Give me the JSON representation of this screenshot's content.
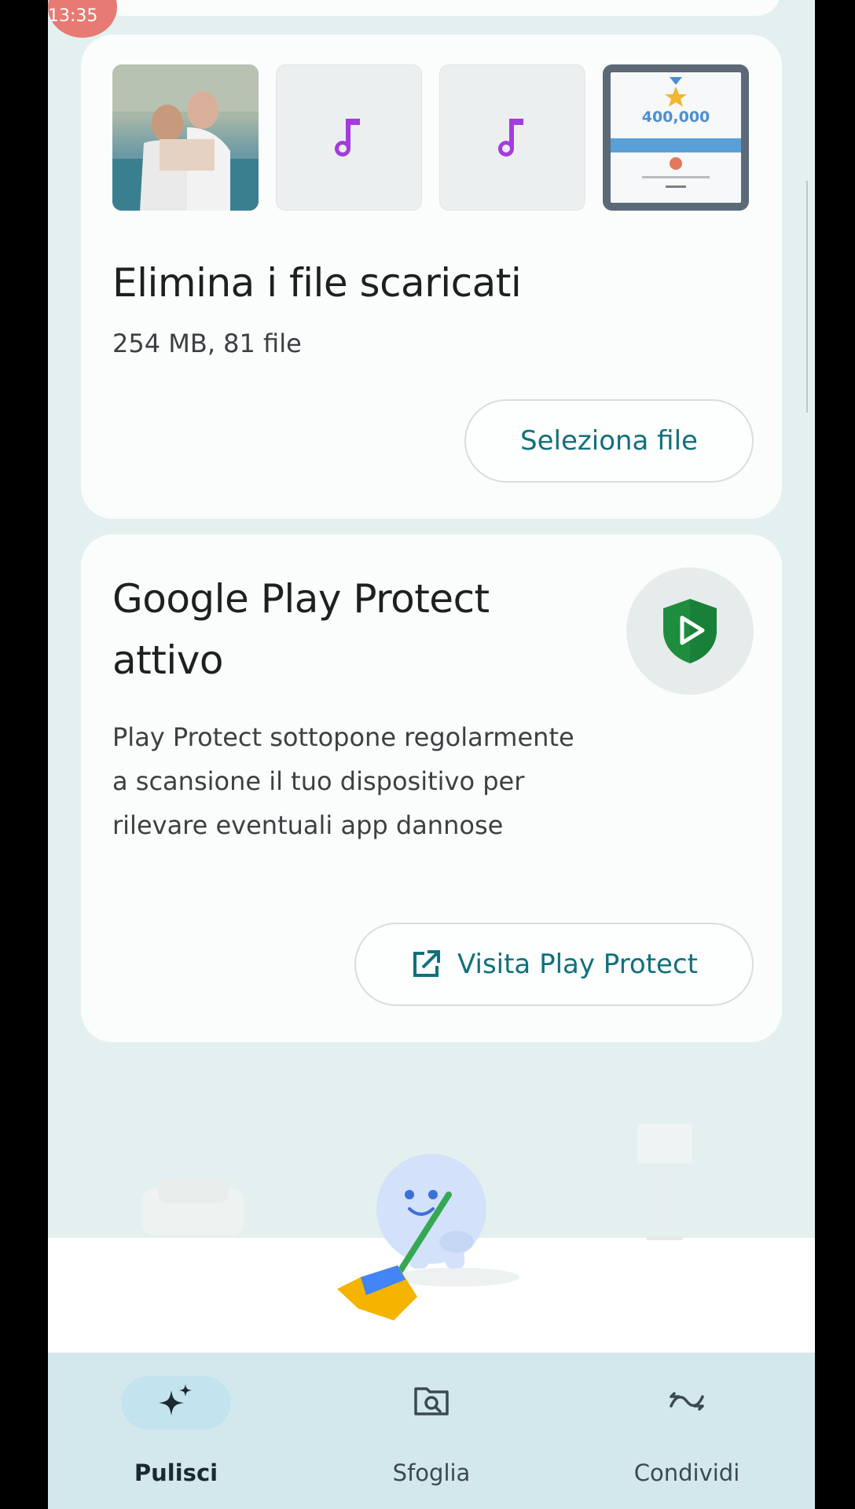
{
  "status": {
    "time": "13:35"
  },
  "downloads_card": {
    "title": "Elimina i file scaricati",
    "summary": "254 MB, 81 file",
    "button_label": "Seleziona file",
    "thumbnails": [
      {
        "kind": "photo"
      },
      {
        "kind": "music",
        "icon": "music-note-icon"
      },
      {
        "kind": "music",
        "icon": "music-note-icon"
      },
      {
        "kind": "certificate",
        "number": "400,000"
      }
    ]
  },
  "protect_card": {
    "title_line1": "Google Play Protect",
    "title_line2": "attivo",
    "description": "Play Protect sottopone regolarmente a scansione il tuo dispositivo per rilevare eventuali app dannose",
    "button_label": "Visita Play Protect"
  },
  "bottom_nav": {
    "items": [
      {
        "label": "Pulisci",
        "icon": "sparkle-icon",
        "active": true
      },
      {
        "label": "Sfoglia",
        "icon": "folder-search-icon",
        "active": false
      },
      {
        "label": "Condividi",
        "icon": "share-arrows-icon",
        "active": false
      }
    ]
  },
  "colors": {
    "accent": "#11707c",
    "background": "#e4f0f0",
    "card": "#fbfcfc",
    "nav_bg": "#d2e8ec",
    "music_icon": "#a43be0",
    "shield": "#1e8e3e"
  }
}
